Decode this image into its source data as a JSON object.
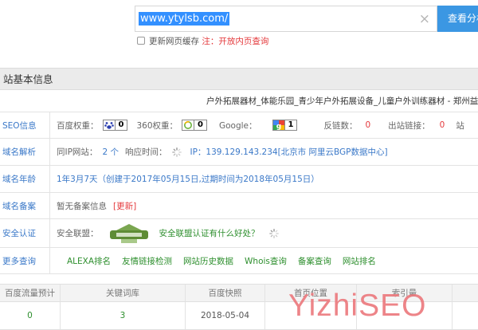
{
  "search": {
    "value": "www.ytylsb.com/",
    "button_label": "查看分析",
    "cache_label": "更新网页缓存",
    "note": "注：开放内页查询"
  },
  "section": {
    "title": "站基本信息"
  },
  "site_title": "户外拓展器材_体能乐园_青少年户外拓展设备_儿童户外训练器材 - 郑州益重",
  "seo": {
    "label": "SEO信息",
    "baidu_label": "百度权重：",
    "baidu_value": "0",
    "s360_label": "360权重：",
    "s360_value": "0",
    "google_label": "Google：",
    "google_value": "1",
    "backlinks_label": "反链数：",
    "backlinks_value": "0",
    "outlinks_label": "出站链接：",
    "outlinks_value": "0",
    "tail": "站"
  },
  "dns": {
    "label": "域名解析",
    "sameip_label": "同IP网站：",
    "sameip_value": "2 个",
    "response_label": "响应时间：",
    "ip_text": "IP：139.129.143.234[北京市 阿里云BGP数据中心]"
  },
  "age": {
    "label": "域名年龄",
    "text": "1年3月7天（创建于2017年05月15日,过期时间为2018年05月15日）"
  },
  "beian": {
    "label": "域名备案",
    "text": "暂无备案信息",
    "update": "[更新]"
  },
  "security": {
    "label": "安全认证",
    "alliance_label": "安全联盟：",
    "link": "安全联盟认证有什么好处？"
  },
  "more": {
    "label": "更多查询",
    "links": [
      "ALEXA排名",
      "友情链接检测",
      "网站历史数据",
      "Whois查询",
      "备案查询",
      "网站排名"
    ]
  },
  "stats": {
    "headers": [
      "百度流量预计",
      "关键词库",
      "百度快照",
      "首页位置",
      "索引量"
    ],
    "values": [
      "0",
      "3",
      "2018-05-04",
      "",
      ""
    ]
  },
  "watermark": "YizhiSEO",
  "colors": {
    "link": "#3a78c8",
    "green": "#2e8f2e",
    "red": "#e4393c",
    "button": "#3b97e3"
  }
}
